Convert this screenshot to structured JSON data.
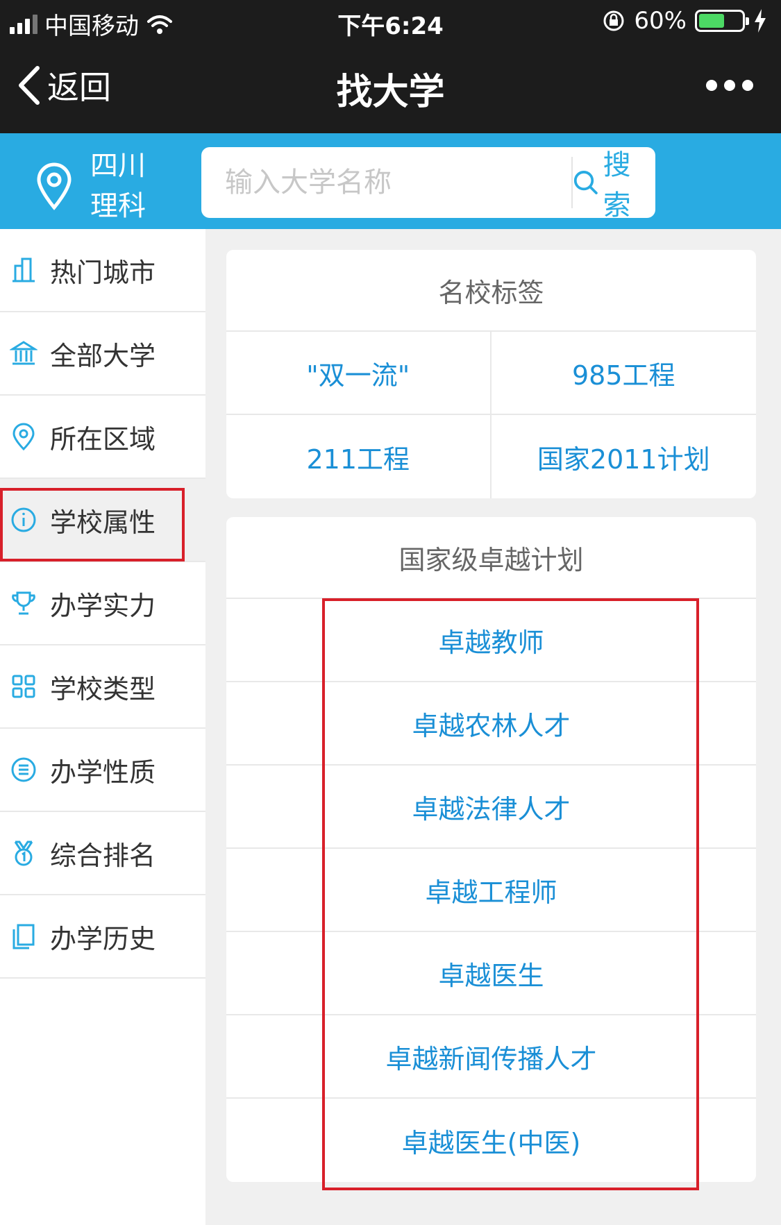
{
  "status_bar": {
    "carrier": "中国移动",
    "time": "下午6:24",
    "battery": "60%",
    "battery_level": 0.6
  },
  "nav": {
    "back_label": "返回",
    "title": "找大学"
  },
  "search": {
    "province": "四川",
    "subject": "理科",
    "placeholder": "输入大学名称",
    "button_label": "搜索"
  },
  "sidebar": {
    "items": [
      {
        "label": "热门城市",
        "icon": "buildings-icon"
      },
      {
        "label": "全部大学",
        "icon": "institution-icon"
      },
      {
        "label": "所在区域",
        "icon": "location-pin-icon"
      },
      {
        "label": "学校属性",
        "icon": "info-icon"
      },
      {
        "label": "办学实力",
        "icon": "trophy-icon"
      },
      {
        "label": "学校类型",
        "icon": "grid-icon"
      },
      {
        "label": "办学性质",
        "icon": "list-circle-icon"
      },
      {
        "label": "综合排名",
        "icon": "medal-icon"
      },
      {
        "label": "办学历史",
        "icon": "book-icon"
      }
    ],
    "active_index": 3
  },
  "famous_tags": {
    "title": "名校标签",
    "items": [
      "\"双一流\"",
      "985工程",
      "211工程",
      "国家2011计划"
    ]
  },
  "excellence_plan": {
    "title": "国家级卓越计划",
    "items": [
      "卓越教师",
      "卓越农林人才",
      "卓越法律人才",
      "卓越工程师",
      "卓越医生",
      "卓越新闻传播人才",
      "卓越医生(中医)"
    ]
  },
  "colors": {
    "accent": "#29abe2",
    "link": "#1a8fd6",
    "highlight": "#d8202a",
    "dark_bar": "#1c1c1c"
  }
}
